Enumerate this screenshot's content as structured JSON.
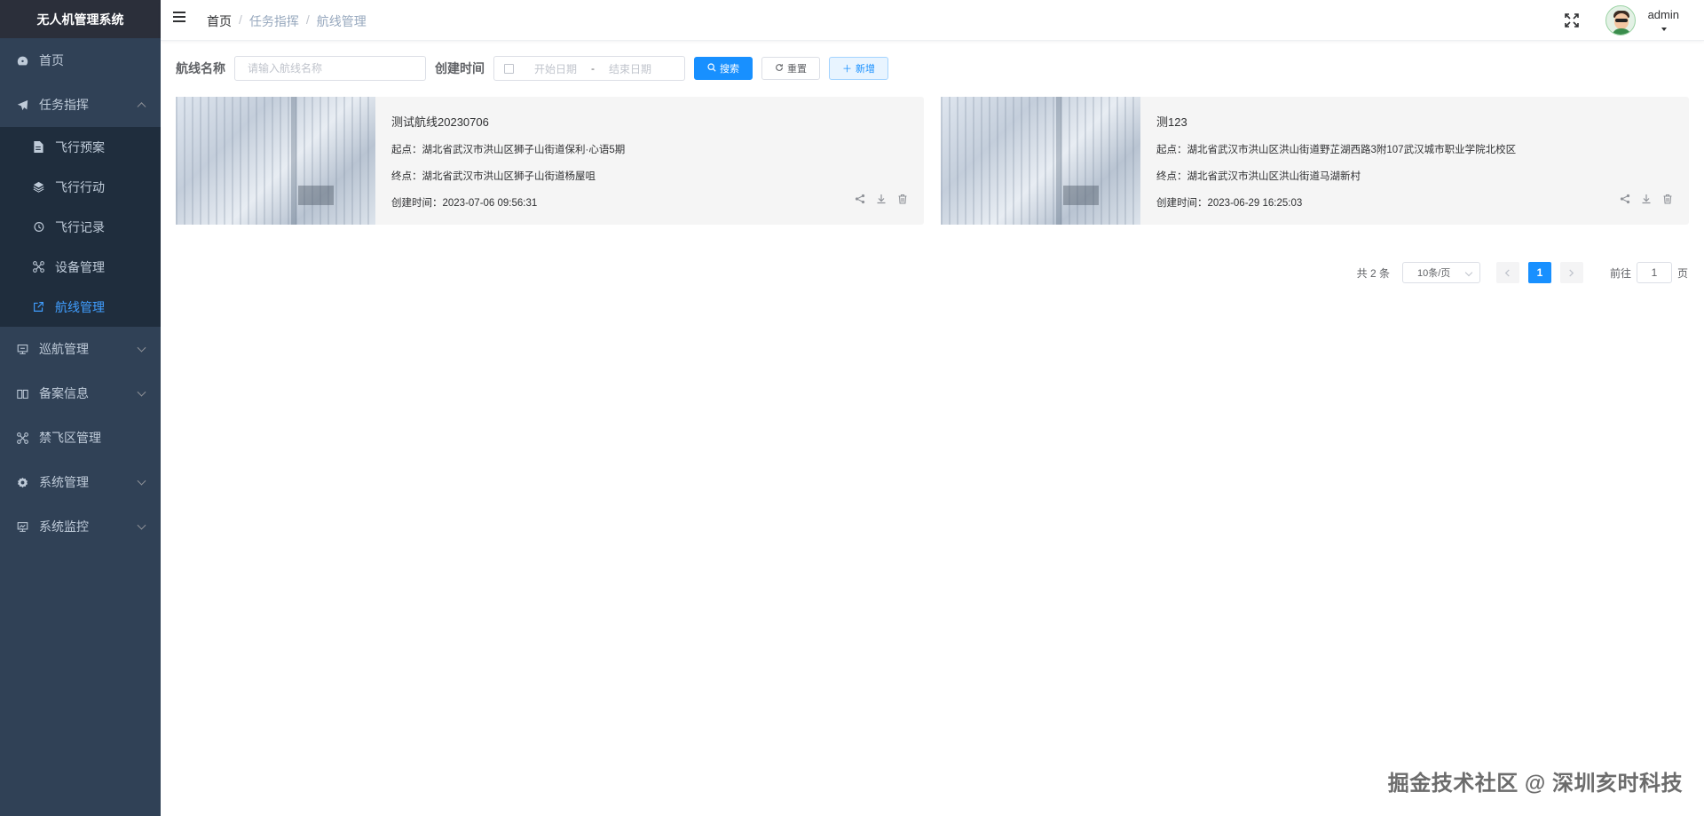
{
  "app": {
    "title": "无人机管理系统"
  },
  "sidebar": {
    "items": [
      {
        "label": "首页",
        "icon": "dashboard-icon"
      },
      {
        "label": "任务指挥",
        "icon": "send-icon",
        "expanded": true,
        "children": [
          {
            "label": "飞行预案",
            "icon": "document-icon"
          },
          {
            "label": "飞行行动",
            "icon": "layers-icon"
          },
          {
            "label": "飞行记录",
            "icon": "history-icon"
          },
          {
            "label": "设备管理",
            "icon": "drone-icon"
          },
          {
            "label": "航线管理",
            "icon": "route-icon",
            "active": true
          }
        ]
      },
      {
        "label": "巡航管理",
        "icon": "monitor-icon"
      },
      {
        "label": "备案信息",
        "icon": "book-icon"
      },
      {
        "label": "禁飞区管理",
        "icon": "drone-icon"
      },
      {
        "label": "系统管理",
        "icon": "gear-icon"
      },
      {
        "label": "系统监控",
        "icon": "monitor-chart-icon"
      }
    ]
  },
  "header": {
    "breadcrumb": [
      "首页",
      "任务指挥",
      "航线管理"
    ],
    "username": "admin"
  },
  "filters": {
    "route_name_label": "航线名称",
    "route_name_placeholder": "请输入航线名称",
    "created_time_label": "创建时间",
    "start_placeholder": "开始日期",
    "date_sep": "-",
    "end_placeholder": "结束日期",
    "search_label": "搜索",
    "reset_label": "重置",
    "add_label": "新增"
  },
  "routes": [
    {
      "name": "测试航线20230706",
      "start": "起点：湖北省武汉市洪山区狮子山街道保利·心语5期",
      "end": "终点：湖北省武汉市洪山区狮子山街道杨屋咀",
      "created": "创建时间：2023-07-06 09:56:31"
    },
    {
      "name": "测123",
      "start": "起点：湖北省武汉市洪山区洪山街道野芷湖西路3附107武汉城市职业学院北校区",
      "end": "终点：湖北省武汉市洪山区洪山街道马湖新村",
      "created": "创建时间：2023-06-29 16:25:03"
    }
  ],
  "pagination": {
    "total": "共 2 条",
    "page_size": "10条/页",
    "current": "1",
    "goto_label": "前往",
    "goto_value": "1",
    "page_suffix": "页"
  },
  "watermark": "掘金技术社区 @ 深圳亥时科技",
  "colors": {
    "sidebar": "#304156",
    "primary": "#1890ff",
    "active": "#409eff"
  }
}
